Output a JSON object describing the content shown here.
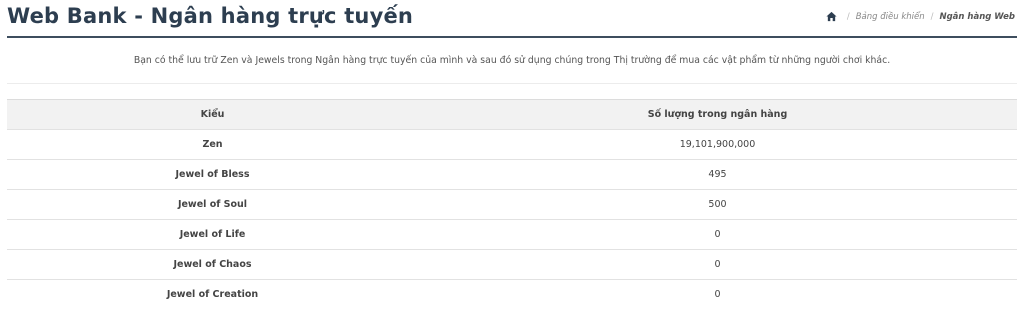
{
  "header": {
    "title": "Web Bank - Ngân hàng trực tuyến",
    "breadcrumb": {
      "home_icon": "home-icon",
      "items": [
        "Bảng điều khiển",
        "Ngân hàng Web"
      ]
    }
  },
  "intro": "Bạn có thể lưu trữ Zen và Jewels trong Ngân hàng trực tuyến của mình và sau đó sử dụng chúng trong Thị trường để mua các vật phẩm từ những người chơi khác.",
  "table": {
    "columns": [
      "Kiểu",
      "Số lượng trong ngân hàng"
    ],
    "rows": [
      {
        "type": "Zen",
        "amount": "19,101,900,000"
      },
      {
        "type": "Jewel of Bless",
        "amount": "495"
      },
      {
        "type": "Jewel of Soul",
        "amount": "500"
      },
      {
        "type": "Jewel of Life",
        "amount": "0"
      },
      {
        "type": "Jewel of Chaos",
        "amount": "0"
      },
      {
        "type": "Jewel of Creation",
        "amount": "0"
      }
    ]
  },
  "colors": {
    "title": "#2d3e50",
    "header_rule": "#3e4e5e",
    "table_head_bg": "#f2f2f2"
  }
}
